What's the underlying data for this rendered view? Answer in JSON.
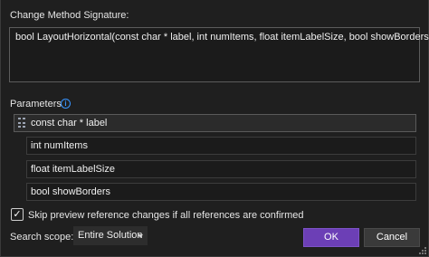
{
  "dialog": {
    "signature_label": "Change Method Signature:",
    "signature_text": "bool LayoutHorizontal(const char * label, int numItems, float itemLabelSize, bool showBorders",
    "signature_close": ")",
    "parameters_label": "Parameters",
    "info_icon": "i",
    "parameters": [
      {
        "label": "const char * label",
        "selected": true
      },
      {
        "label": "int numItems",
        "selected": false
      },
      {
        "label": "float itemLabelSize",
        "selected": false
      },
      {
        "label": "bool showBorders",
        "selected": false
      }
    ],
    "skip_preview_label": "Skip preview reference changes if all references are confirmed",
    "skip_preview_checked": true,
    "check_mark": "✓",
    "search_scope_label": "Search scope:",
    "search_scope_value": "Entire Solution",
    "ok_label": "OK",
    "cancel_label": "Cancel"
  },
  "colors": {
    "background": "#1f1f1f",
    "accent": "#6c3fb6",
    "info": "#3794ff"
  }
}
